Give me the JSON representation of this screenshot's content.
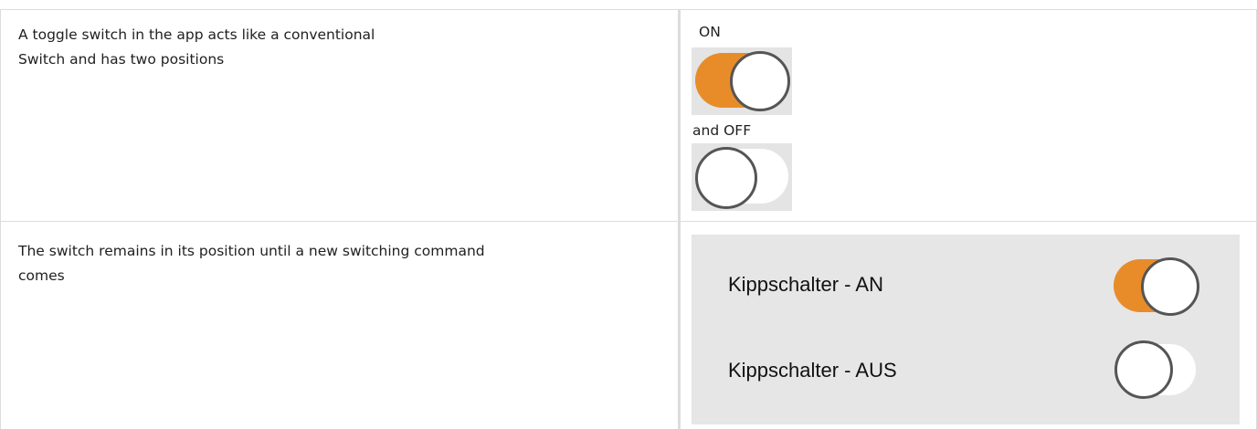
{
  "rows": [
    {
      "description": "A toggle switch in the app acts like a conventional\nSwitch and has two positions",
      "on_label": "ON",
      "off_label": "and OFF"
    },
    {
      "description": "The switch remains in its position until a new switching command\ncomes",
      "panel": {
        "item_on_label": "Kippschalter - AN",
        "item_off_label": "Kippschalter - AUS"
      }
    }
  ],
  "colors": {
    "accent_on": "#e88c2a",
    "track_off": "#ffffff",
    "knob_border": "#555555",
    "panel_bg": "#e6e6e6",
    "border": "#dcdcdc"
  },
  "switch_states": {
    "row1_top": "on",
    "row1_bottom": "off",
    "panel_top": "on",
    "panel_bottom": "off"
  }
}
